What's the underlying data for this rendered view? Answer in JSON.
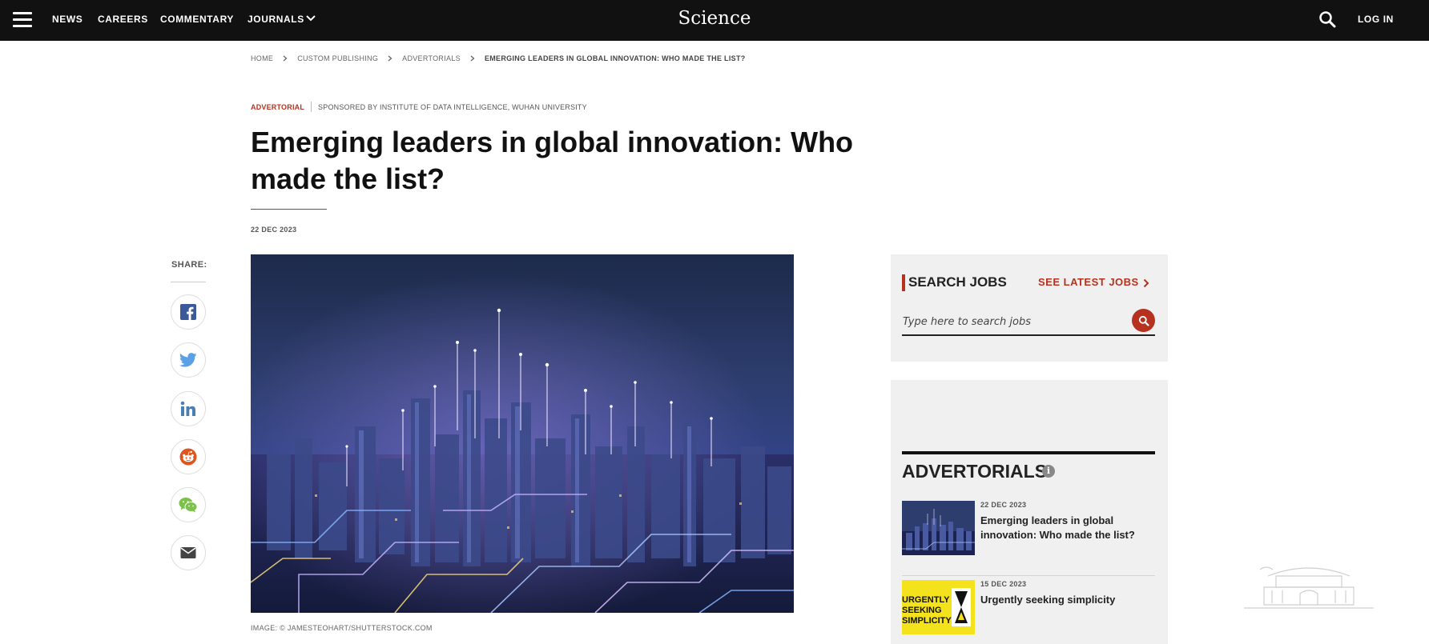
{
  "nav": {
    "items": [
      "NEWS",
      "CAREERS",
      "COMMENTARY",
      "JOURNALS"
    ],
    "logo": "Science",
    "login": "LOG IN"
  },
  "breadcrumb": [
    "HOME",
    "CUSTOM PUBLISHING",
    "ADVERTORIALS",
    "EMERGING LEADERS IN GLOBAL INNOVATION: WHO MADE THE LIST?"
  ],
  "article": {
    "tag": "ADVERTORIAL",
    "sponsor": "SPONSORED BY INSTITUTE OF DATA INTELLIGENCE, WUHAN UNIVERSITY",
    "title": "Emerging leaders in global innovation: Who made the list?",
    "date": "22 DEC 2023",
    "image_caption": "IMAGE: © JAMESTEOHART/SHUTTERSTOCK.COM"
  },
  "share": {
    "label": "SHARE:",
    "icons": [
      "facebook-icon",
      "twitter-icon",
      "linkedin-icon",
      "reddit-icon",
      "wechat-icon",
      "email-icon"
    ]
  },
  "jobs": {
    "title": "SEARCH JOBS",
    "link": "SEE LATEST JOBS",
    "placeholder": "Type here to search jobs"
  },
  "advertorials": {
    "title": "ADVERTORIALS",
    "items": [
      {
        "date": "22 DEC 2023",
        "headline": "Emerging leaders in global innovation: Who made the list?"
      },
      {
        "date": "15 DEC 2023",
        "headline": "Urgently seeking simplicity",
        "thumb_text": "URGENTLY SEEKING SIMPLICITY"
      }
    ]
  },
  "colors": {
    "nav_bg": "#111111",
    "accent": "#b6321f",
    "sidebar_bg": "#f0f0f0"
  }
}
